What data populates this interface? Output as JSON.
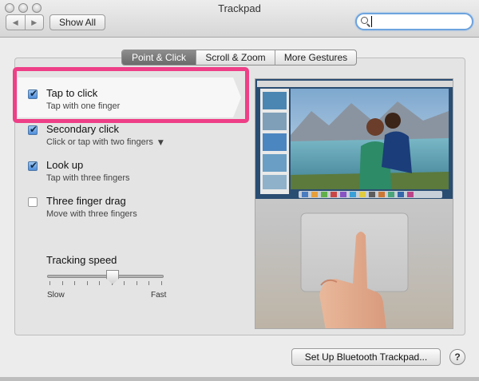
{
  "window": {
    "title": "Trackpad",
    "show_all_label": "Show All",
    "search": {
      "value": "",
      "placeholder": ""
    }
  },
  "tabs": [
    {
      "label": "Point & Click",
      "selected": true
    },
    {
      "label": "Scroll & Zoom",
      "selected": false
    },
    {
      "label": "More Gestures",
      "selected": false
    }
  ],
  "options": [
    {
      "label": "Tap to click",
      "sub": "Tap with one finger",
      "checked": true
    },
    {
      "label": "Secondary click",
      "sub": "Click or tap with two fingers",
      "checked": true
    },
    {
      "label": "Look up",
      "sub": "Tap with three fingers",
      "checked": true
    },
    {
      "label": "Three finger drag",
      "sub": "Move with three fingers",
      "checked": false
    }
  ],
  "tracking": {
    "label": "Tracking speed",
    "min_label": "Slow",
    "max_label": "Fast",
    "value": 0.5
  },
  "footer": {
    "setup_bluetooth_label": "Set Up Bluetooth Trackpad...",
    "help_label": "?"
  },
  "colors": {
    "highlight": "#ee3f87",
    "accent": "#4f8ddb"
  }
}
